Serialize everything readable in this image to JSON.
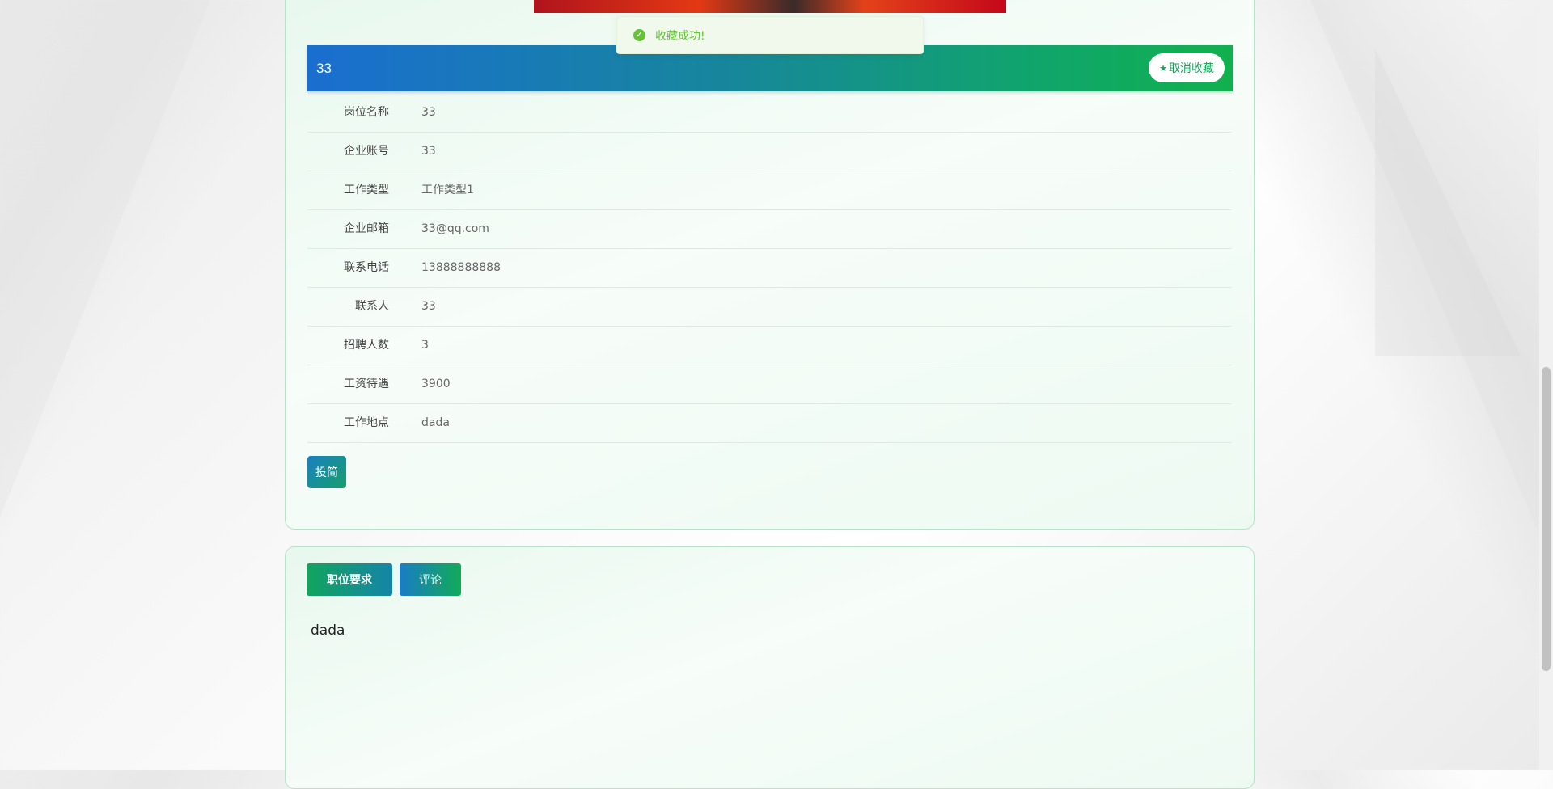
{
  "toast": {
    "message": "收藏成功!"
  },
  "job": {
    "title": "33",
    "unfavorite_label": "取消收藏",
    "fields": [
      {
        "label": "岗位名称",
        "value": "33"
      },
      {
        "label": "企业账号",
        "value": "33"
      },
      {
        "label": "工作类型",
        "value": "工作类型1"
      },
      {
        "label": "企业邮箱",
        "value": "33@qq.com"
      },
      {
        "label": "联系电话",
        "value": "13888888888"
      },
      {
        "label": "联系人",
        "value": "33"
      },
      {
        "label": "招聘人数",
        "value": "3"
      },
      {
        "label": "工资待遇",
        "value": "3900"
      },
      {
        "label": "工作地点",
        "value": "dada"
      }
    ],
    "apply_label": "投简"
  },
  "tabs": {
    "items": [
      {
        "label": "职位要求"
      },
      {
        "label": "评论"
      }
    ],
    "active_content": "dada"
  },
  "colors": {
    "accent_green": "#11b04e",
    "accent_blue": "#1a6ed0",
    "toast_green": "#67c23a"
  },
  "icons": {
    "toast": "check-circle-icon",
    "unfavorite": "star-icon"
  }
}
